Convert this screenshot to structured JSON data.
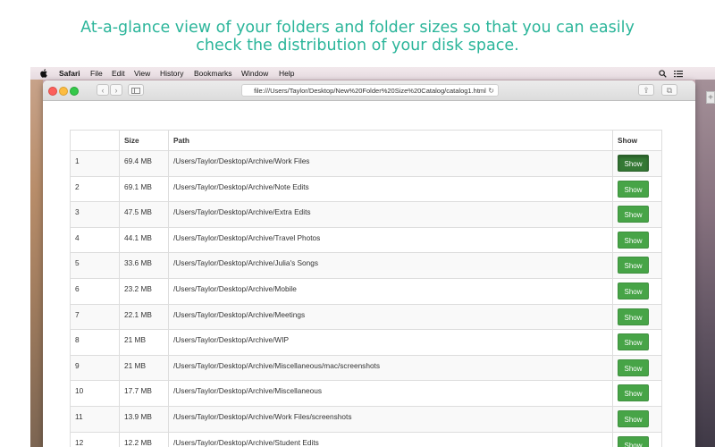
{
  "caption": {
    "line1": "At-a-glance view of your folders and folder sizes so that you can easily",
    "line2": "check the distribution of your disk space."
  },
  "menubar": {
    "apple_icon": "apple-icon",
    "app_name": "Safari",
    "menus": [
      "File",
      "Edit",
      "View",
      "History",
      "Bookmarks",
      "Window",
      "Help"
    ],
    "right_icons": [
      "search-icon",
      "list-icon"
    ]
  },
  "browser": {
    "address": "file:///Users/Taylor/Desktop/New%20Folder%20Size%20Catalog/catalog1.html",
    "back_glyph": "‹",
    "forward_glyph": "›",
    "reload_glyph": "↻",
    "share_glyph": "⇪",
    "tabs_glyph": "⧉",
    "new_tab_glyph": "+"
  },
  "table": {
    "headers": [
      "",
      "Size",
      "Path",
      "Show"
    ],
    "button_label": "Show",
    "rows": [
      {
        "index": "1",
        "size": "69.4 MB",
        "path": "/Users/Taylor/Desktop/Archive/Work Files"
      },
      {
        "index": "2",
        "size": "69.1 MB",
        "path": "/Users/Taylor/Desktop/Archive/Note Edits"
      },
      {
        "index": "3",
        "size": "47.5 MB",
        "path": "/Users/Taylor/Desktop/Archive/Extra Edits"
      },
      {
        "index": "4",
        "size": "44.1 MB",
        "path": "/Users/Taylor/Desktop/Archive/Travel Photos"
      },
      {
        "index": "5",
        "size": "33.6 MB",
        "path": "/Users/Taylor/Desktop/Archive/Julia's Songs"
      },
      {
        "index": "6",
        "size": "23.2 MB",
        "path": "/Users/Taylor/Desktop/Archive/Mobile"
      },
      {
        "index": "7",
        "size": "22.1 MB",
        "path": "/Users/Taylor/Desktop/Archive/Meetings"
      },
      {
        "index": "8",
        "size": "21 MB",
        "path": "/Users/Taylor/Desktop/Archive/WIP"
      },
      {
        "index": "9",
        "size": "21 MB",
        "path": "/Users/Taylor/Desktop/Archive/Miscellaneous/mac/screenshots"
      },
      {
        "index": "10",
        "size": "17.7 MB",
        "path": "/Users/Taylor/Desktop/Archive/Miscellaneous"
      },
      {
        "index": "11",
        "size": "13.9 MB",
        "path": "/Users/Taylor/Desktop/Archive/Work Files/screenshots"
      },
      {
        "index": "12",
        "size": "12.2 MB",
        "path": "/Users/Taylor/Desktop/Archive/Student Edits"
      }
    ]
  },
  "colors": {
    "caption": "#2bb59a",
    "button": "#47a447",
    "button_active": "#357935"
  }
}
